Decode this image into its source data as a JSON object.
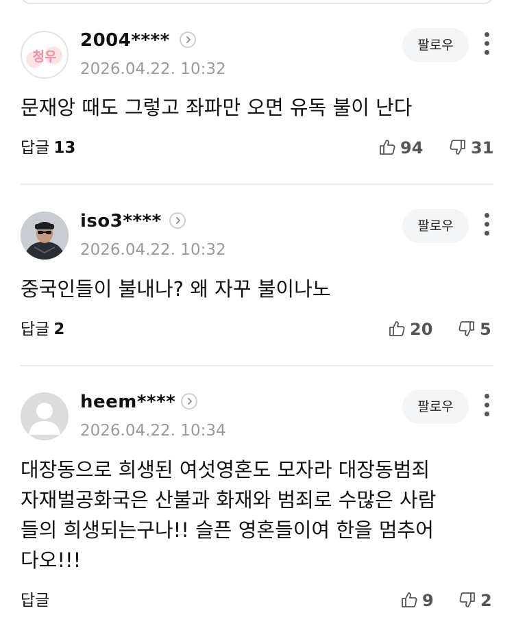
{
  "comments": [
    {
      "username": "2004****",
      "timestamp": "2026.04.22. 10:32",
      "follow_label": "팔로우",
      "avatar_text": "청우",
      "body": "문재앙 때도 그렇고 좌파만 오면 유독 불이 난다",
      "reply_label": "답글",
      "reply_count": "13",
      "likes": "94",
      "dislikes": "31"
    },
    {
      "username": "iso3****",
      "timestamp": "2026.04.22. 10:32",
      "follow_label": "팔로우",
      "body": "중국인들이 불내나? 왜 자꾸 불이나노",
      "reply_label": "답글",
      "reply_count": "2",
      "likes": "20",
      "dislikes": "5"
    },
    {
      "username": "heem****",
      "timestamp": "2026.04.22. 10:34",
      "follow_label": "팔로우",
      "body": "대장동으로 희생된 여섯영혼도 모자라 대장동범죄\n자재벌공화국은 산불과 화재와 범죄로 수많은 사람\n들의 희생되는구나!! 슬픈 영혼들이여 한을 멈추어\n다오!!!",
      "reply_label": "답글",
      "reply_count": "",
      "likes": "9",
      "dislikes": "2"
    }
  ],
  "colors": {
    "text": "#111111",
    "meta": "#9a9a9a",
    "follow_bg": "#f4f5f7",
    "divider": "#ececec",
    "avatar_pink": "#f08fa6"
  },
  "icons": {
    "profile": "chevron-right-icon",
    "more": "more-vertical-icon",
    "like": "thumbs-up-icon",
    "dislike": "thumbs-down-icon",
    "default_avatar": "default-user-icon"
  }
}
